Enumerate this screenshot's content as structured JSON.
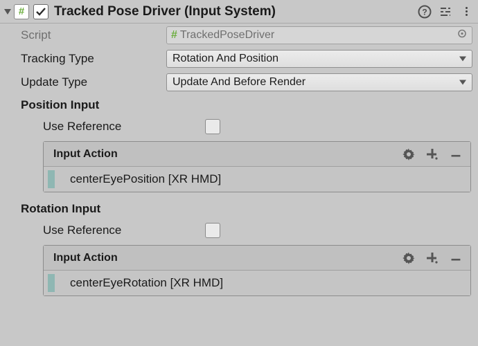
{
  "header": {
    "title": "Tracked Pose Driver (Input System)",
    "enabled": true
  },
  "script": {
    "label": "Script",
    "value": "TrackedPoseDriver"
  },
  "tracking_type": {
    "label": "Tracking Type",
    "value": "Rotation And Position"
  },
  "update_type": {
    "label": "Update Type",
    "value": "Update And Before Render"
  },
  "position_input": {
    "heading": "Position Input",
    "use_reference_label": "Use Reference",
    "use_reference": false,
    "action_label": "Input Action",
    "binding": "centerEyePosition [XR HMD]"
  },
  "rotation_input": {
    "heading": "Rotation Input",
    "use_reference_label": "Use Reference",
    "use_reference": false,
    "action_label": "Input Action",
    "binding": "centerEyeRotation [XR HMD]"
  }
}
